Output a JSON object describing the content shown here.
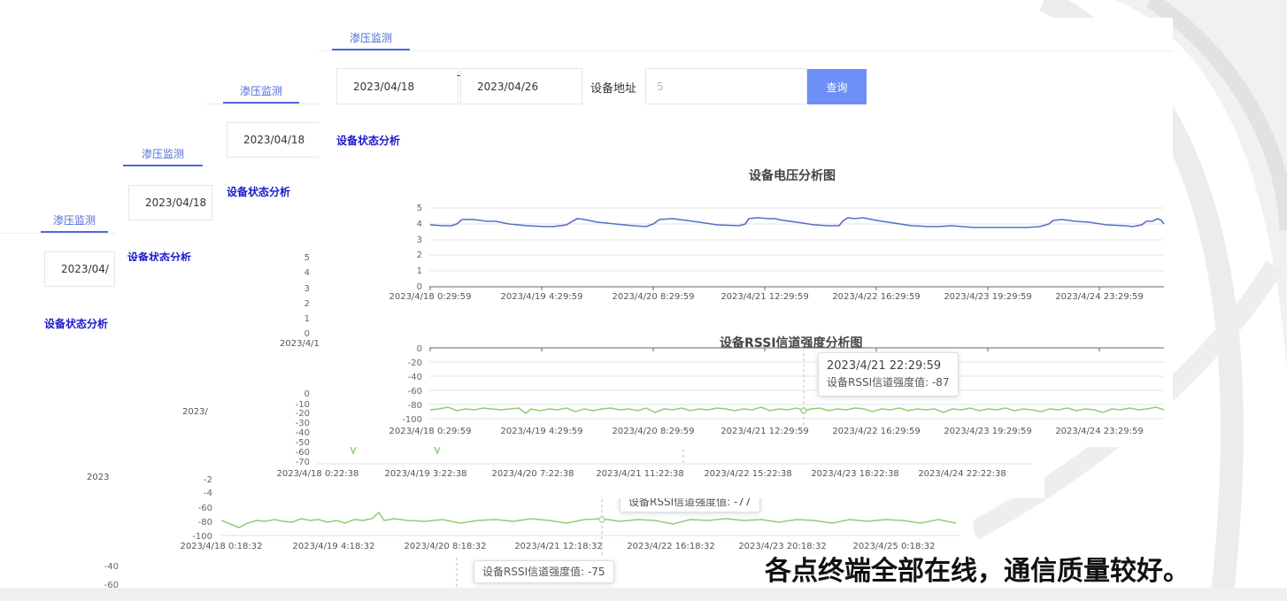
{
  "tabs": {
    "shenya": "渗压监测"
  },
  "filter": {
    "start_date": "2023/04/18",
    "end_date": "2023/04/26",
    "separator": "-",
    "address_label": "设备地址",
    "address_value": "5",
    "query_label": "查询",
    "start_date_clipped": "2023/04/"
  },
  "section_title": "设备状态分析",
  "voltage_chart": {
    "title": "设备电压分析图",
    "y_ticks": [
      "0",
      "1",
      "2",
      "3",
      "4",
      "5"
    ],
    "x_ticks": [
      "2023/4/18 0:29:59",
      "2023/4/19 4:29:59",
      "2023/4/20 8:29:59",
      "2023/4/21 12:29:59",
      "2023/4/22 16:29:59",
      "2023/4/23 19:29:59",
      "2023/4/24 23:29:59"
    ],
    "color": "#5470c6"
  },
  "rssi_chart": {
    "title": "设备RSSI信道强度分析图",
    "y_ticks": [
      "0",
      "-20",
      "-40",
      "-60",
      "-80",
      "-100"
    ],
    "x_ticks": [
      "2023/4/18 0:29:59",
      "2023/4/19 4:29:59",
      "2023/4/20 8:29:59",
      "2023/4/21 12:29:59",
      "2023/4/22 16:29:59",
      "2023/4/23 19:29:59",
      "2023/4/24 23:29:59"
    ],
    "color": "#91cc75",
    "tooltip_time": "2023/4/21 22:29:59",
    "tooltip_text": "设备RSSI信道强度值: -87"
  },
  "layer2": {
    "y_ticks_voltage": [
      "5",
      "4",
      "3",
      "2",
      "1",
      "0"
    ],
    "x_label_clipped": "2023/4/1",
    "y_ticks_rssi": [
      "0",
      "-10",
      "-20",
      "-30",
      "-40",
      "-50",
      "-60",
      "-70"
    ],
    "x_ticks": [
      "2023/4/18 0:22:38",
      "2023/4/19 3:22:38",
      "2023/4/20 7:22:38",
      "2023/4/21 11:22:38",
      "2023/4/22 15:22:38",
      "2023/4/23 18:22:38",
      "2023/4/24 22:22:38"
    ]
  },
  "layer3": {
    "x_label_clipped1": "2023/",
    "x_label_clipped2": "2023",
    "y_ticks_rssi": [
      "-2",
      "-4",
      "-60",
      "-80",
      "-100"
    ],
    "x_ticks": [
      "2023/4/18 0:18:32",
      "2023/4/19 4:18:32",
      "2023/4/20 8:18:32",
      "2023/4/21 12:18:32",
      "2023/4/22 16:18:32",
      "2023/4/23 20:18:32",
      "2023/4/25 0:18:32"
    ],
    "tooltip_text": "设备RSSI信道强度值: -77"
  },
  "layer4": {
    "y_ticks": [
      "-40",
      "-60"
    ],
    "tooltip_text": "设备RSSI信道强度值: -75"
  },
  "caption": "各点终端全部在线，通信质量较好。"
}
